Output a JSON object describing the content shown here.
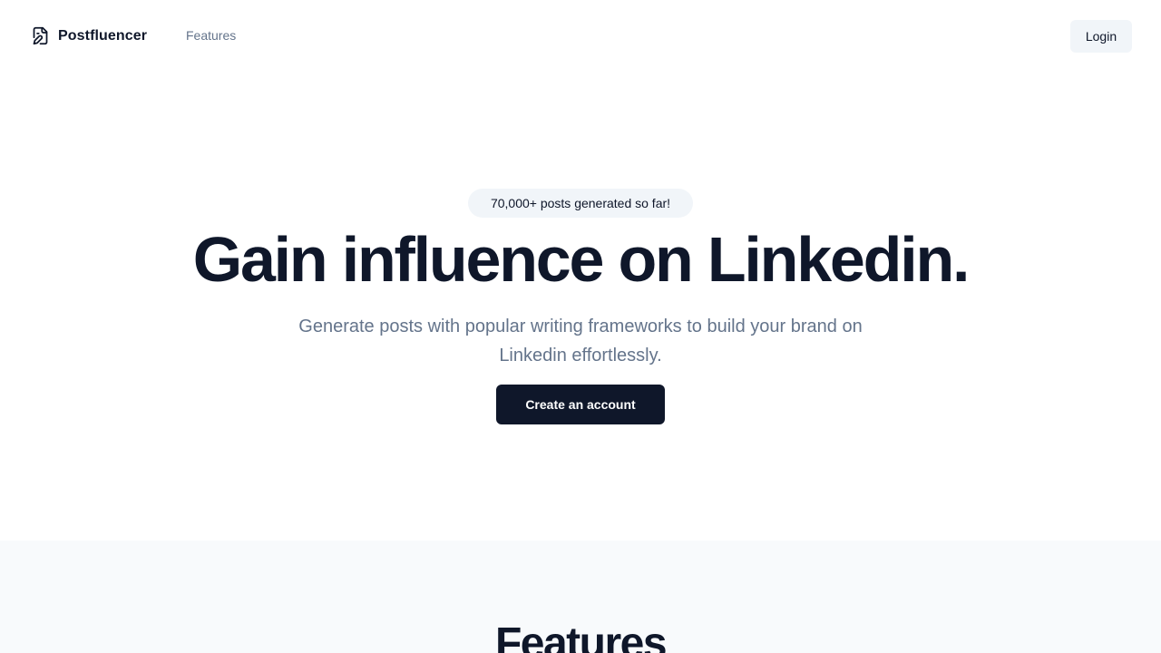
{
  "header": {
    "brand_name": "Postfluencer",
    "brand_icon": "file-pen-icon",
    "nav": [
      {
        "label": "Features"
      }
    ],
    "login_label": "Login"
  },
  "hero": {
    "badge": "70,000+ posts generated so far!",
    "title": "Gain influence on Linkedin.",
    "subtitle": "Generate posts with popular writing frameworks to build your brand on Linkedin effortlessly.",
    "cta_label": "Create an account"
  },
  "features": {
    "heading": "Features"
  },
  "colors": {
    "primary": "#0f172a",
    "muted_text": "#64748b",
    "secondary_bg": "#f1f5f9",
    "section_bg": "#f8fafc"
  }
}
